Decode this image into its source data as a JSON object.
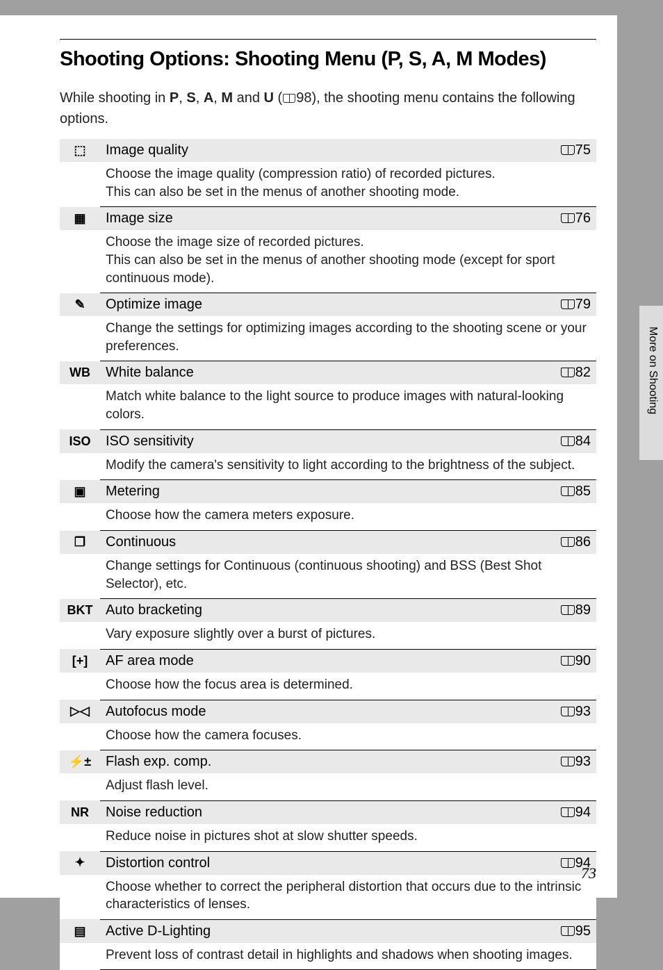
{
  "title_prefix": "Shooting Options: Shooting Menu (",
  "title_modes": "P, S, A, M",
  "title_suffix": " Modes)",
  "intro_pre": "While shooting in ",
  "intro_modes": "P, S, A, M",
  "intro_mid": " and ",
  "intro_u": "U",
  "intro_ref": "98",
  "intro_post": "), the shooting menu contains the following options.",
  "side_label": "More on Shooting",
  "page_number": "73",
  "items": [
    {
      "icon": "image-quality-icon",
      "glyph": "⬚",
      "title": "Image quality",
      "page": "75",
      "desc": "Choose the image quality (compression ratio) of recorded pictures.\nThis can also be set in the menus of another shooting mode."
    },
    {
      "icon": "image-size-icon",
      "glyph": "▦",
      "title": "Image size",
      "page": "76",
      "desc": "Choose the image size of recorded pictures.\nThis can also be set in the menus of another shooting mode (except for sport continuous mode)."
    },
    {
      "icon": "optimize-icon",
      "glyph": "✎",
      "title": "Optimize image",
      "page": "79",
      "desc": "Change the settings for optimizing images according to the shooting scene or your preferences."
    },
    {
      "icon": "white-balance-icon",
      "glyph": "WB",
      "title": "White balance",
      "page": "82",
      "desc": "Match white balance to the light source to produce images with natural-looking colors."
    },
    {
      "icon": "iso-icon",
      "glyph": "ISO",
      "title": "ISO sensitivity",
      "page": "84",
      "desc": "Modify the camera's sensitivity to light according to the brightness of the subject."
    },
    {
      "icon": "metering-icon",
      "glyph": "▣",
      "title": "Metering",
      "page": "85",
      "desc": "Choose how the camera meters exposure."
    },
    {
      "icon": "continuous-icon",
      "glyph": "❐",
      "title": "Continuous",
      "page": "86",
      "desc": "Change settings for Continuous (continuous shooting) and BSS (Best Shot Selector), etc."
    },
    {
      "icon": "bracketing-icon",
      "glyph": "BKT",
      "title": "Auto bracketing",
      "page": "89",
      "desc": "Vary exposure slightly over a burst of pictures."
    },
    {
      "icon": "af-area-icon",
      "glyph": "[+]",
      "title": "AF area mode",
      "page": "90",
      "desc": "Choose how the focus area is determined."
    },
    {
      "icon": "autofocus-icon",
      "glyph": "▷◁",
      "title": "Autofocus mode",
      "page": "93",
      "desc": "Choose how the camera focuses."
    },
    {
      "icon": "flash-comp-icon",
      "glyph": "⚡±",
      "title": "Flash exp. comp.",
      "page": "93",
      "desc": "Adjust flash level."
    },
    {
      "icon": "noise-reduction-icon",
      "glyph": "NR",
      "title": "Noise reduction",
      "page": "94",
      "desc": "Reduce noise in pictures shot at slow shutter speeds."
    },
    {
      "icon": "distortion-icon",
      "glyph": "✦",
      "title": "Distortion control",
      "page": "94",
      "desc": "Choose whether to correct the peripheral distortion that occurs due to the intrinsic characteristics of lenses."
    },
    {
      "icon": "dlighting-icon",
      "glyph": "▤",
      "title": "Active D-Lighting",
      "page": "95",
      "desc": "Prevent loss of contrast detail in highlights and shadows when shooting images."
    }
  ]
}
